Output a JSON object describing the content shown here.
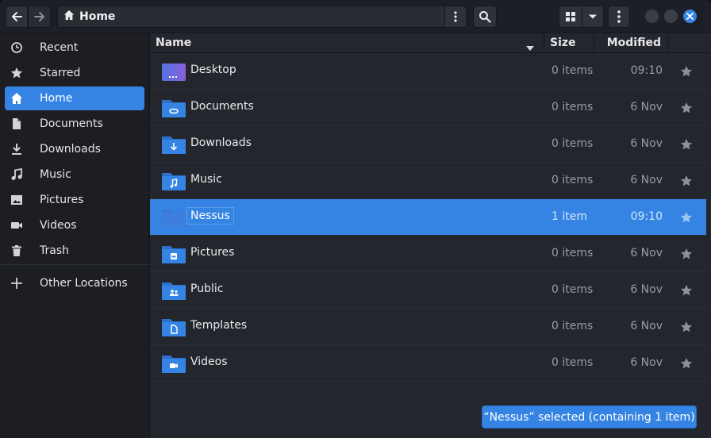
{
  "header": {
    "location": "Home",
    "icons": {
      "back": "arrow-left-icon",
      "forward": "arrow-right-icon",
      "home": "home-icon",
      "path_menu": "vertical-dots-icon",
      "search": "search-icon",
      "view": "grid-view-icon",
      "view_options": "chevron-down-icon",
      "menu": "vertical-dots-icon",
      "close": "close-icon"
    }
  },
  "sidebar": {
    "items": [
      {
        "label": "Recent",
        "icon": "clock-icon"
      },
      {
        "label": "Starred",
        "icon": "star-icon"
      },
      {
        "label": "Home",
        "icon": "home-icon",
        "active": true
      },
      {
        "label": "Documents",
        "icon": "document-icon"
      },
      {
        "label": "Downloads",
        "icon": "download-icon"
      },
      {
        "label": "Music",
        "icon": "music-note-icon"
      },
      {
        "label": "Pictures",
        "icon": "picture-icon"
      },
      {
        "label": "Videos",
        "icon": "video-camera-icon"
      },
      {
        "label": "Trash",
        "icon": "trash-icon"
      }
    ],
    "other": {
      "label": "Other Locations",
      "icon": "plus-icon"
    }
  },
  "list": {
    "columns": {
      "name": "Name",
      "size": "Size",
      "modified": "Modified"
    },
    "rows": [
      {
        "name": "Desktop",
        "size": "0 items",
        "modified": "09:10",
        "icon": "desktop-folder-icon"
      },
      {
        "name": "Documents",
        "size": "0 items",
        "modified": "6 Nov",
        "icon": "documents-folder-icon"
      },
      {
        "name": "Downloads",
        "size": "0 items",
        "modified": "6 Nov",
        "icon": "downloads-folder-icon"
      },
      {
        "name": "Music",
        "size": "0 items",
        "modified": "6 Nov",
        "icon": "music-folder-icon"
      },
      {
        "name": "Nessus",
        "size": "1 item",
        "modified": "09:10",
        "icon": "folder-icon",
        "selected": true
      },
      {
        "name": "Pictures",
        "size": "0 items",
        "modified": "6 Nov",
        "icon": "pictures-folder-icon"
      },
      {
        "name": "Public",
        "size": "0 items",
        "modified": "6 Nov",
        "icon": "public-folder-icon"
      },
      {
        "name": "Templates",
        "size": "0 items",
        "modified": "6 Nov",
        "icon": "templates-folder-icon"
      },
      {
        "name": "Videos",
        "size": "0 items",
        "modified": "6 Nov",
        "icon": "videos-folder-icon"
      }
    ]
  },
  "status": {
    "text": "“Nessus” selected  (containing 1 item)"
  },
  "colors": {
    "accent": "#3584e4",
    "background": "#24262e",
    "sidebar": "#1c1e24"
  }
}
